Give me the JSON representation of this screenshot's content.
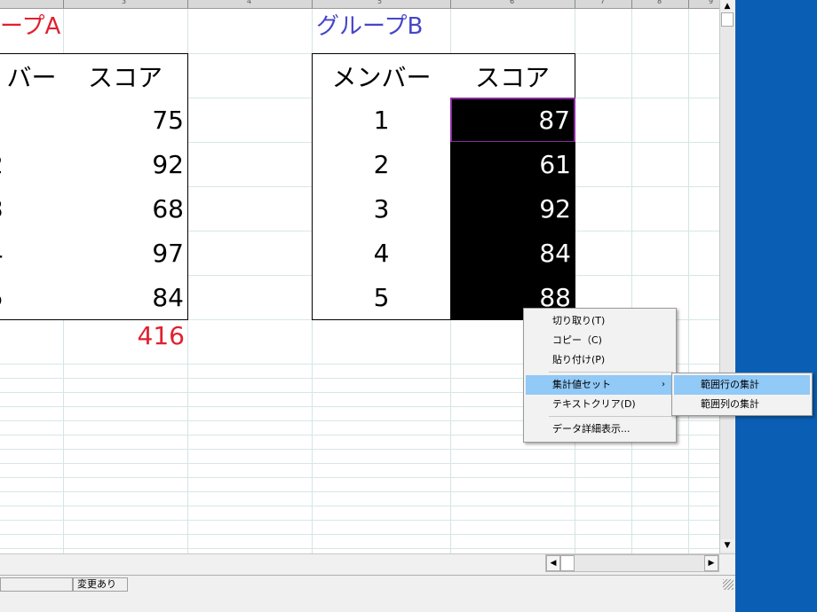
{
  "columns": [
    "3",
    "4",
    "5",
    "6",
    "7",
    "8",
    "9"
  ],
  "group_a": {
    "title": "ープA",
    "headers": [
      "バー",
      "スコア"
    ],
    "rows": [
      {
        "member": "",
        "score": "75"
      },
      {
        "member": "2",
        "score": "92"
      },
      {
        "member": "3",
        "score": "68"
      },
      {
        "member": "4",
        "score": "97"
      },
      {
        "member": "5",
        "score": "84"
      }
    ],
    "total": "416"
  },
  "group_b": {
    "title": "グループB",
    "headers": [
      "メンバー",
      "スコア"
    ],
    "rows": [
      {
        "member": "1",
        "score": "87"
      },
      {
        "member": "2",
        "score": "61"
      },
      {
        "member": "3",
        "score": "92"
      },
      {
        "member": "4",
        "score": "84"
      },
      {
        "member": "5",
        "score": "88"
      }
    ]
  },
  "context_menu": {
    "items": [
      "切り取り(T)",
      "コピー（C)",
      "貼り付け(P)",
      "集計値セット",
      "テキストクリア(D)",
      "データ詳細表示..."
    ],
    "highlighted": "集計値セット"
  },
  "submenu": {
    "items": [
      "範囲行の集計",
      "範囲列の集計"
    ],
    "highlighted": "範囲行の集計"
  },
  "status_bar": {
    "modified": "変更あり"
  },
  "colors": {
    "group_a_title": "#e0202f",
    "group_b_title": "#4646c8",
    "total": "#e0202f",
    "selection_bg": "#000000",
    "menu_highlight": "#91c9f7",
    "desktop": "#0a5fb4"
  }
}
